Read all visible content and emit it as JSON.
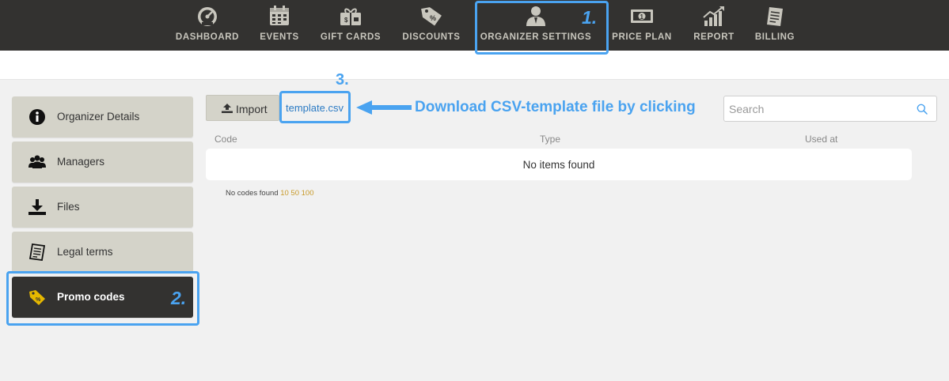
{
  "nav": {
    "items": [
      {
        "label": "DASHBOARD",
        "icon": "dashboard-gauge-icon"
      },
      {
        "label": "EVENTS",
        "icon": "calendar-icon"
      },
      {
        "label": "GIFT CARDS",
        "icon": "gift-card-icon"
      },
      {
        "label": "DISCOUNTS",
        "icon": "discount-tag-icon"
      },
      {
        "label": "ORGANIZER SETTINGS",
        "icon": "organizer-user-icon"
      },
      {
        "label": "PRICE PLAN",
        "icon": "banknote-icon"
      },
      {
        "label": "REPORT",
        "icon": "chart-growth-icon"
      },
      {
        "label": "BILLING",
        "icon": "invoice-icon"
      }
    ]
  },
  "sidebar": {
    "items": [
      {
        "label": "Organizer Details",
        "icon": "info-icon"
      },
      {
        "label": "Managers",
        "icon": "users-icon"
      },
      {
        "label": "Files",
        "icon": "download-icon"
      },
      {
        "label": "Legal terms",
        "icon": "document-icon"
      },
      {
        "label": "Promo codes",
        "icon": "promo-tag-icon",
        "active": true
      }
    ]
  },
  "toolbar": {
    "import_label": "Import",
    "template_link": "template.csv",
    "search_placeholder": "Search"
  },
  "table": {
    "columns": [
      "Code",
      "Type",
      "Used at"
    ],
    "empty_message": "No items found"
  },
  "pager": {
    "status": "No codes found",
    "page_sizes": [
      "10",
      "50",
      "100"
    ]
  },
  "annotations": {
    "step1": "1.",
    "step2": "2.",
    "step3": "3.",
    "instruction": "Download CSV-template file by clicking"
  },
  "colors": {
    "nav_bg": "#333230",
    "nav_text": "#c8c6bd",
    "sidebar_item": "#d4d3c9",
    "sidebar_active": "#333230",
    "highlight": "#4aa3f0",
    "link": "#2c7bc4",
    "pager_option": "#c89a2a"
  }
}
